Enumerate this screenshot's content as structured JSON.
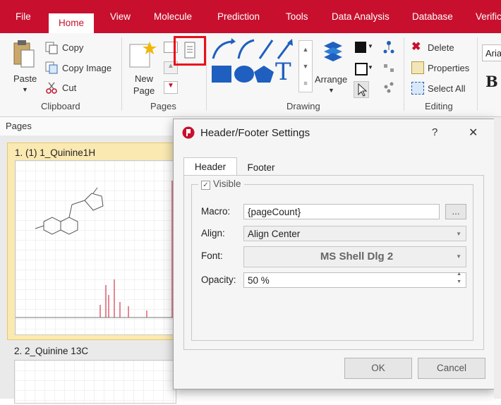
{
  "menu": {
    "tabs": [
      "File",
      "Home",
      "View",
      "Molecule",
      "Prediction",
      "Tools",
      "Data Analysis",
      "Database",
      "Verific"
    ]
  },
  "ribbon": {
    "clipboard": {
      "paste": "Paste",
      "copy": "Copy",
      "copy_image": "Copy Image",
      "cut": "Cut",
      "group": "Clipboard"
    },
    "pages": {
      "new_page": "New Page",
      "group": "Pages"
    },
    "drawing": {
      "arrange": "Arrange",
      "group": "Drawing",
      "text_tool": "T"
    },
    "editing": {
      "delete": "Delete",
      "properties": "Properties",
      "select_all": "Select All",
      "group": "Editing"
    },
    "font": {
      "name": "Aria",
      "bold": "B"
    }
  },
  "pages_panel": {
    "title": "Pages",
    "items": [
      {
        "label": "1. (1) 1_Quinine1H"
      },
      {
        "label": "2. 2_Quinine 13C"
      }
    ]
  },
  "dialog": {
    "title": "Header/Footer Settings",
    "help": "?",
    "close": "✕",
    "tabs": [
      "Header",
      "Footer"
    ],
    "visible_label": "Visible",
    "macro_label": "Macro:",
    "macro_value": "{pageCount}",
    "macro_btn": "...",
    "align_label": "Align:",
    "align_value": "Align Center",
    "font_label": "Font:",
    "font_value": "MS Shell Dlg 2",
    "opacity_label": "Opacity:",
    "opacity_value": "50 %",
    "ok": "OK",
    "cancel": "Cancel"
  },
  "colors": {
    "brand": "#c8102e",
    "highlight": "#e8101a",
    "drawing_blue": "#1f5fbf"
  }
}
